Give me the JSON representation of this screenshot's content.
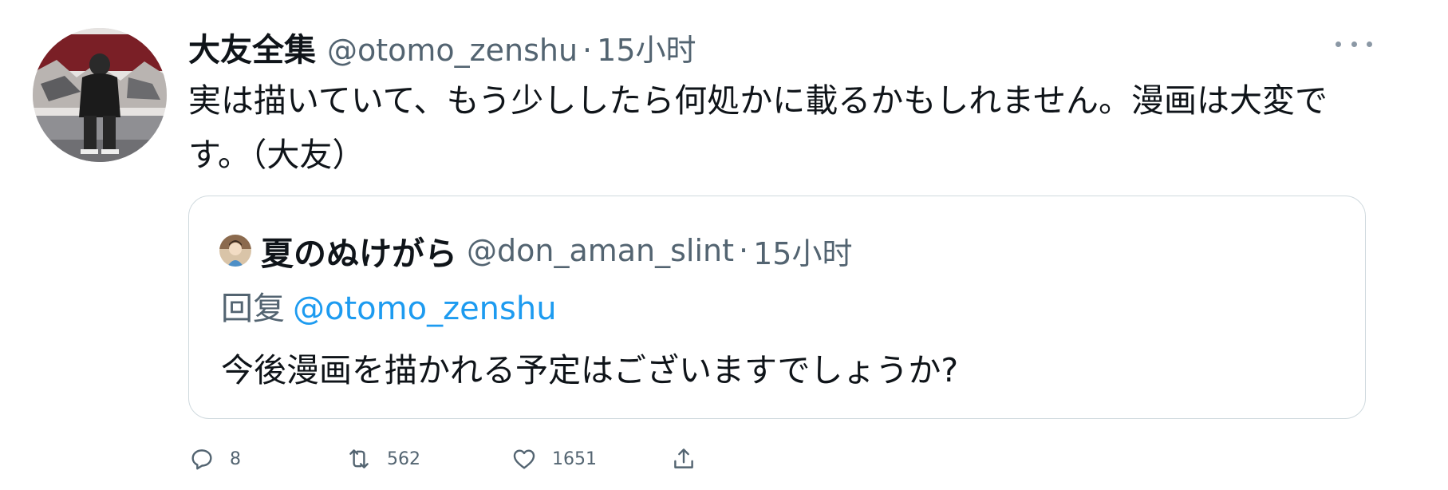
{
  "tweet": {
    "author": {
      "display_name": "大友全集",
      "handle": "@otomo_zenshu",
      "avatar_icon": "profile-photo"
    },
    "separator": "·",
    "time": "15小时",
    "more_icon": "more-horizontal-icon",
    "text": "実は描いていて、もう少ししたら何処かに載るかもしれません。漫画は大変です。（大友）"
  },
  "quote": {
    "author": {
      "display_name": "夏のぬけがら",
      "handle": "@don_aman_slint",
      "avatar_icon": "profile-photo"
    },
    "separator": "·",
    "time": "15小时",
    "reply_prefix": "回复",
    "reply_mention": "@otomo_zenshu",
    "text": "今後漫画を描かれる予定はございますでしょうか?"
  },
  "actions": {
    "reply": {
      "icon": "reply-icon",
      "count": "8"
    },
    "retweet": {
      "icon": "retweet-icon",
      "count": "562"
    },
    "like": {
      "icon": "heart-icon",
      "count": "1651"
    },
    "share": {
      "icon": "share-icon"
    }
  },
  "colors": {
    "text_primary": "#0f1419",
    "text_secondary": "#536471",
    "link": "#1d9bf0",
    "border": "#cfd9de"
  }
}
